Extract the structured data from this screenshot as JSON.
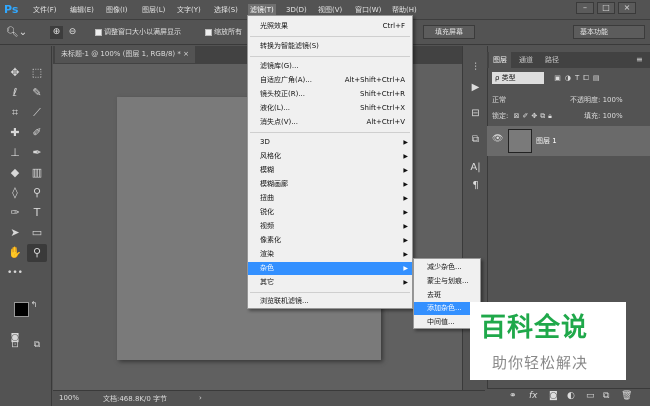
{
  "menubar": {
    "logo": "Ps",
    "items": [
      "文件(F)",
      "编辑(E)",
      "图像(I)",
      "图层(L)",
      "文字(Y)",
      "选择(S)",
      "滤镜(T)",
      "3D(D)",
      "视图(V)",
      "窗口(W)",
      "帮助(H)"
    ],
    "active_index": 6,
    "win_controls": [
      "–",
      "□",
      "×"
    ]
  },
  "options": {
    "fit_window": "调整窗口大小以满屏显示",
    "zoom_all": "缩放所有",
    "fill_screen": "填充屏幕",
    "workspace": "基本功能"
  },
  "document": {
    "tab_title": "未标题-1 @ 100% (图层 1, RGB/8) * ×",
    "zoom": "100%",
    "doc_info": "文档:468.8K/0 字节"
  },
  "filter_menu": {
    "items": [
      {
        "label": "光照效果",
        "shortcut": "Ctrl+F"
      },
      {
        "label": "转换为智能滤镜(S)",
        "shortcut": ""
      },
      {
        "label": "滤镜库(G)...",
        "shortcut": ""
      },
      {
        "label": "自适应广角(A)...",
        "shortcut": "Alt+Shift+Ctrl+A"
      },
      {
        "label": "镜头校正(R)...",
        "shortcut": "Shift+Ctrl+R"
      },
      {
        "label": "液化(L)...",
        "shortcut": "Shift+Ctrl+X"
      },
      {
        "label": "消失点(V)...",
        "shortcut": "Alt+Ctrl+V"
      },
      {
        "label": "3D",
        "shortcut": ""
      },
      {
        "label": "风格化",
        "shortcut": ""
      },
      {
        "label": "模糊",
        "shortcut": ""
      },
      {
        "label": "模糊画廊",
        "shortcut": ""
      },
      {
        "label": "扭曲",
        "shortcut": ""
      },
      {
        "label": "锐化",
        "shortcut": ""
      },
      {
        "label": "视频",
        "shortcut": ""
      },
      {
        "label": "像素化",
        "shortcut": ""
      },
      {
        "label": "渲染",
        "shortcut": ""
      },
      {
        "label": "杂色",
        "shortcut": ""
      },
      {
        "label": "其它",
        "shortcut": ""
      },
      {
        "label": "浏览联机滤镜...",
        "shortcut": ""
      }
    ]
  },
  "noise_submenu": {
    "items": [
      "减少杂色...",
      "蒙尘与划痕...",
      "去斑",
      "添加杂色...",
      "中间值..."
    ],
    "highlight_index": 3
  },
  "layers_panel": {
    "tabs": [
      "图层",
      "通道",
      "路径"
    ],
    "filter_label": "ρ 类型",
    "blend_mode": "正常",
    "opacity": "不透明度: 100%",
    "lock_label": "锁定:",
    "fill": "填充: 100%",
    "layer_name": "图层 1"
  },
  "watermark": {
    "title": "百科全说",
    "subtitle": "助你轻松解决"
  },
  "colors": {
    "highlight": "#3390ff",
    "watermark_green": "#1fa84a"
  }
}
